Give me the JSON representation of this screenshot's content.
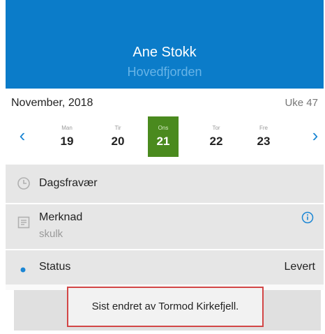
{
  "header": {
    "name": "Ane Stokk",
    "subtitle": "Hovedfjorden"
  },
  "calendar": {
    "month": "November, 2018",
    "week": "Uke 47",
    "days": [
      {
        "name": "Man",
        "date": "19"
      },
      {
        "name": "Tir",
        "date": "20"
      },
      {
        "name": "Ons",
        "date": "21"
      },
      {
        "name": "Tor",
        "date": "22"
      },
      {
        "name": "Fre",
        "date": "23"
      }
    ],
    "selected_day": "21"
  },
  "rows": {
    "absence": {
      "label": "Dagsfravær",
      "icon": "clock-icon"
    },
    "note": {
      "label": "Merknad",
      "value": "skulk",
      "icon": "note-icon",
      "info_icon": "info-icon"
    },
    "status": {
      "label": "Status",
      "value": "Levert",
      "icon": "bullet-icon"
    }
  },
  "toast": {
    "text": "Sist endret av Tormod Kirkefjell."
  },
  "colors": {
    "header_bg": "#0b7cc9",
    "selected_day": "#4a8a1e",
    "accent": "#1b86d4",
    "toast_border": "#d24646"
  }
}
